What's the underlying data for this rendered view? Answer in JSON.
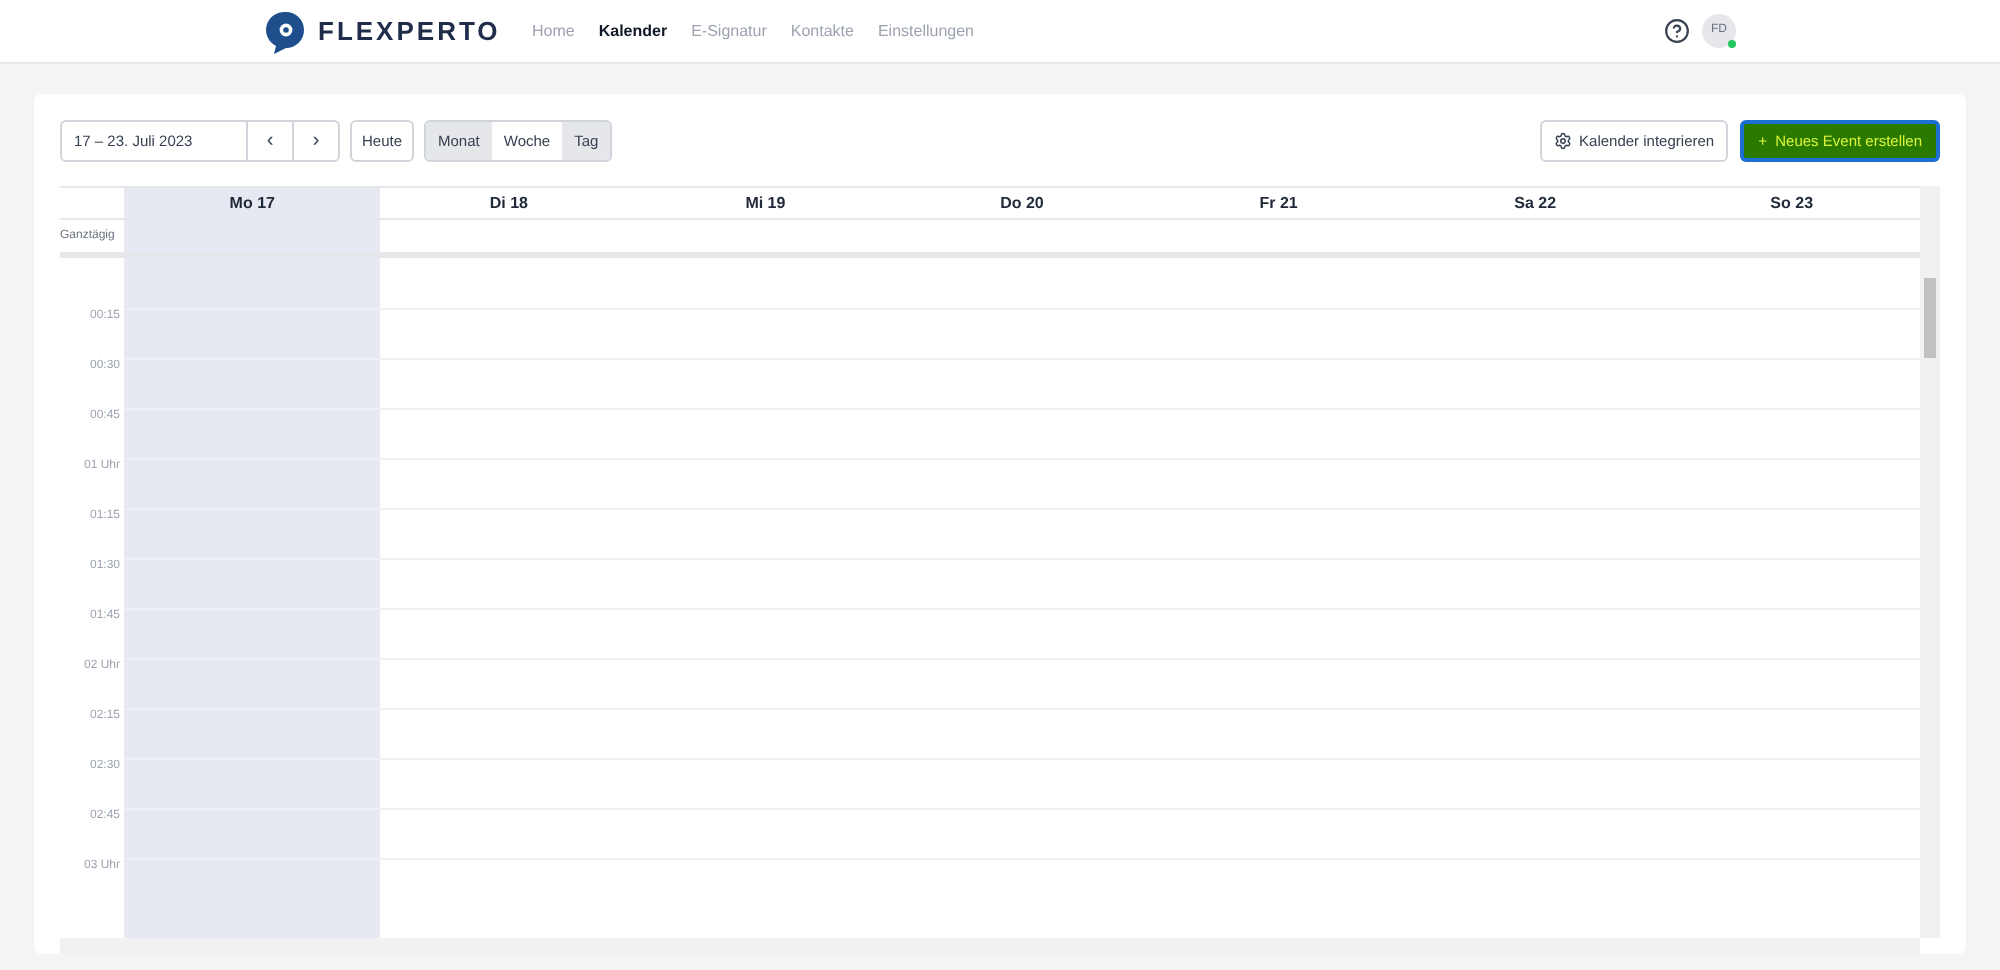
{
  "brand": "FLEXPERTO",
  "nav": [
    {
      "label": "Home",
      "selected": false
    },
    {
      "label": "Kalender",
      "selected": true
    },
    {
      "label": "E-Signatur",
      "selected": false
    },
    {
      "label": "Kontakte",
      "selected": false
    },
    {
      "label": "Einstellungen",
      "selected": false
    }
  ],
  "user": {
    "initials": "FD",
    "online": true
  },
  "toolbar": {
    "range": "17 – 23. Juli 2023",
    "prev": "‹",
    "next": "›",
    "today": "Heute",
    "views": [
      {
        "label": "Monat",
        "selected": false
      },
      {
        "label": "Woche",
        "selected": true
      },
      {
        "label": "Tag",
        "selected": false
      }
    ],
    "integrate": "Kalender integrieren",
    "create": "+  Neues Event erstellen"
  },
  "calendar": {
    "all_day_label": "Ganztägig",
    "days": [
      {
        "label": "Mo 17",
        "today": true
      },
      {
        "label": "Di 18",
        "today": false
      },
      {
        "label": "Mi 19",
        "today": false
      },
      {
        "label": "Do 20",
        "today": false
      },
      {
        "label": "Fr 21",
        "today": false
      },
      {
        "label": "Sa 22",
        "today": false
      },
      {
        "label": "So 23",
        "today": false
      }
    ],
    "times": [
      "00:15",
      "00:30",
      "00:45",
      "01 Uhr",
      "01:15",
      "01:30",
      "01:45",
      "02 Uhr",
      "02:15",
      "02:30",
      "02:45",
      "03 Uhr"
    ]
  }
}
